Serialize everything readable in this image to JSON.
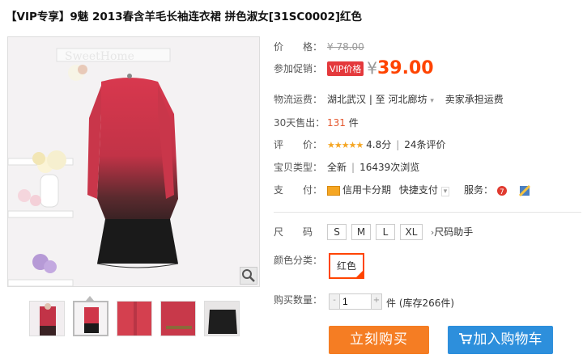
{
  "title": "【VIP专享】9魅 2013春含羊毛长袖连衣裙 拼色淑女[31SC0002]红色",
  "image": {
    "wall_text": "SweetHome"
  },
  "price": {
    "label": "价　　格：",
    "original": "¥ 78.00"
  },
  "promo": {
    "label": "参加促销：",
    "badge": "VIP价格",
    "yen": "¥",
    "price": "39.00"
  },
  "shipping": {
    "label": "物流运费：",
    "route": "湖北武汉 | 至  河北廊坊",
    "fee": "卖家承担运费"
  },
  "sold": {
    "label": "30天售出：",
    "count": "131",
    "unit": "件"
  },
  "rating": {
    "label": "评　　价：",
    "stars": "★★★★★",
    "score": "4.8分",
    "reviews": "24条评价"
  },
  "type": {
    "label": "宝贝类型：",
    "condition": "全新",
    "views": "16439次浏览"
  },
  "payment": {
    "label": "支　　付：",
    "card": "信用卡分期",
    "quick": "快捷支付",
    "service_label": "服务："
  },
  "size": {
    "label": "尺　　码",
    "options": [
      "S",
      "M",
      "L",
      "XL"
    ],
    "helper": "尺码助手"
  },
  "color": {
    "label": "颜色分类：",
    "selected": "红色"
  },
  "quantity": {
    "label": "购买数量：",
    "value": "1",
    "minus": "-",
    "plus": "+",
    "unit": "件",
    "stock": "(库存266件)"
  },
  "buttons": {
    "buy": "立刻购买",
    "cart": "加入购物车"
  },
  "colors": {
    "accent": "#ff4400",
    "buy_bg": "#f57d23",
    "cart_bg": "#2d8fdc",
    "vip_bg": "#e4393c"
  }
}
